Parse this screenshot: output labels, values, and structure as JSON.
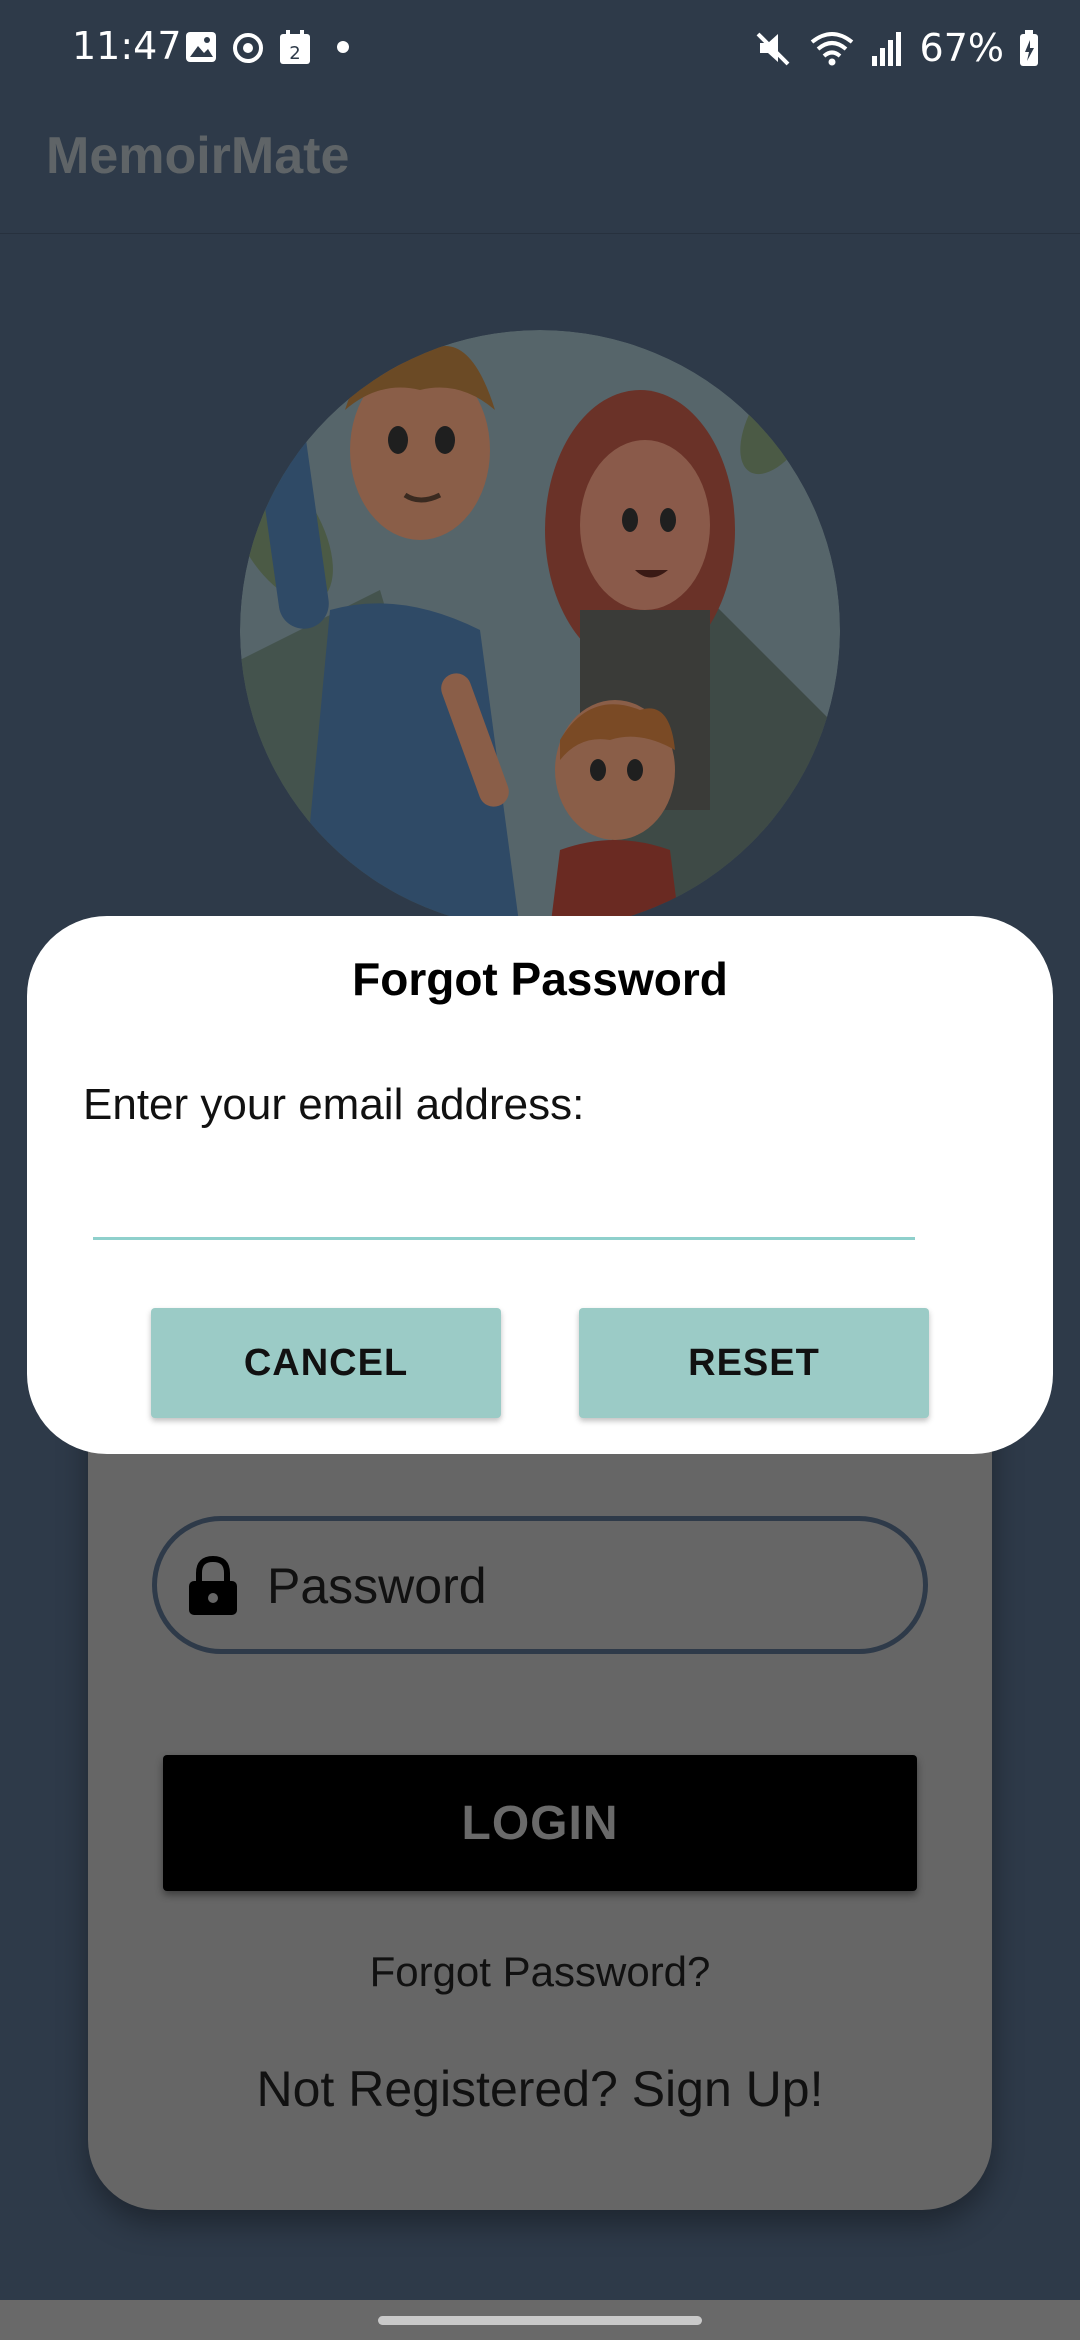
{
  "status_bar": {
    "time": "11:47",
    "notification_badge": "2",
    "battery": "67%",
    "icons": [
      "gallery-icon",
      "sync-icon",
      "calendar-icon",
      "dot-icon",
      "mute-icon",
      "wifi-icon",
      "signal-icon",
      "battery-icon"
    ]
  },
  "app_bar": {
    "title": "MemoirMate"
  },
  "login_card": {
    "password_placeholder": "Password",
    "login_label": "LOGIN",
    "forgot_link": "Forgot Password?",
    "signup_link": "Not Registered? Sign Up!"
  },
  "dialog": {
    "title": "Forgot Password",
    "message": "Enter your email address:",
    "email_value": "",
    "cancel_label": "CANCEL",
    "reset_label": "RESET",
    "accent_color": "#9bcbc6"
  },
  "colors": {
    "background": "#2e3a49",
    "dim_overlay_card": "#666666",
    "button_dark": "#000000"
  }
}
